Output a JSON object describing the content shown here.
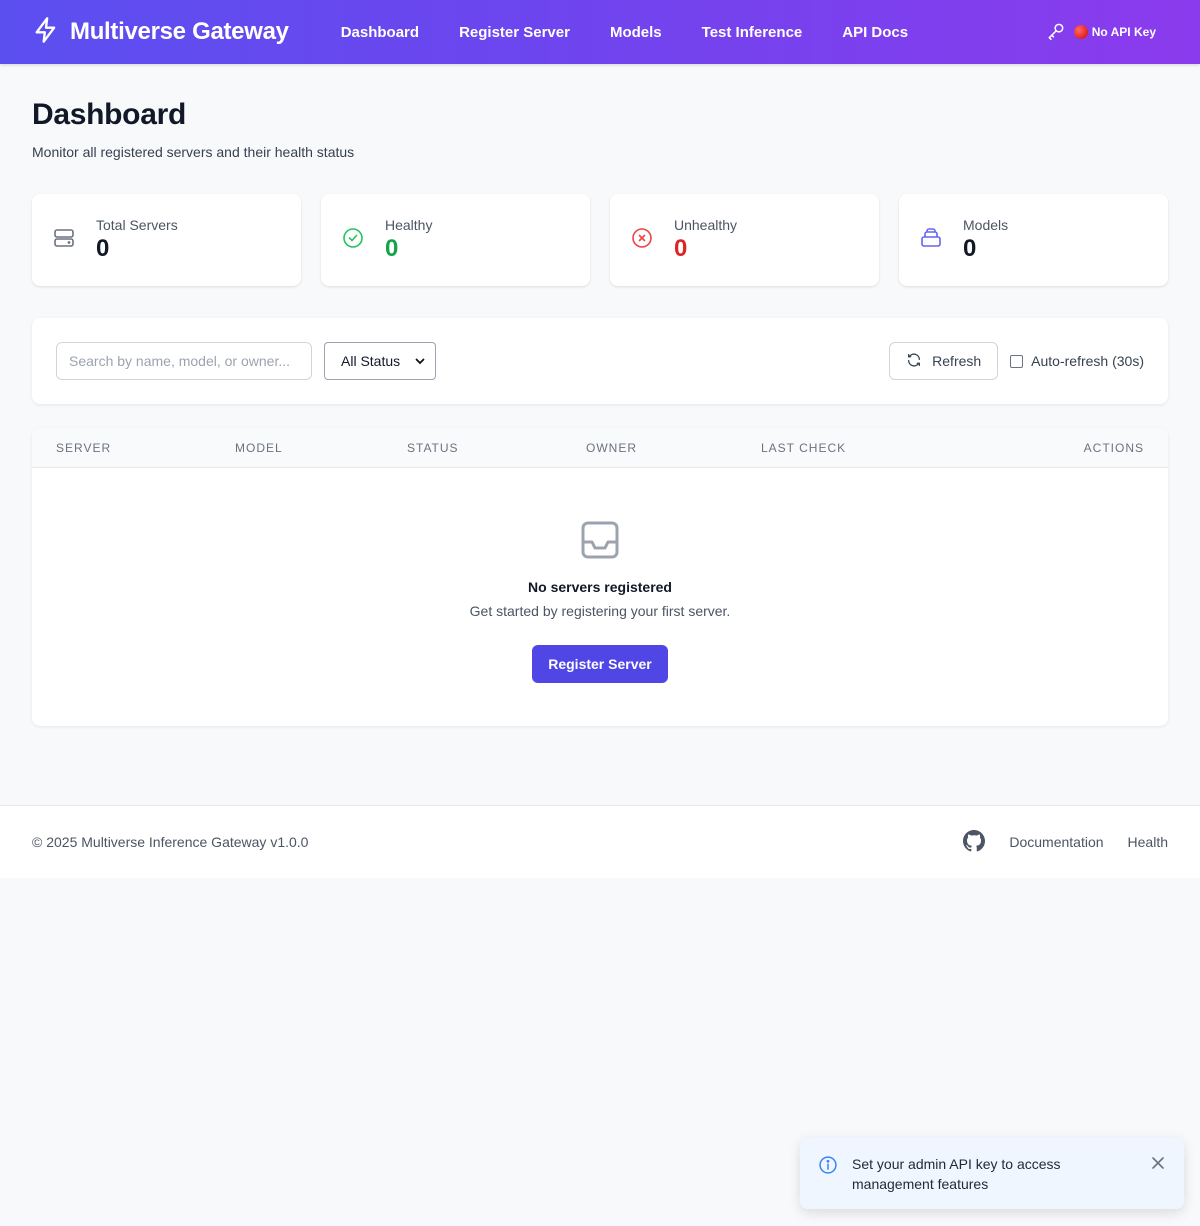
{
  "header": {
    "brand": "Multiverse Gateway",
    "nav": [
      "Dashboard",
      "Register Server",
      "Models",
      "Test Inference",
      "API Docs"
    ],
    "api_key_status": "No API Key"
  },
  "page": {
    "title": "Dashboard",
    "subtitle": "Monitor all registered servers and their health status"
  },
  "stats": [
    {
      "label": "Total Servers",
      "value": "0",
      "color": "#111827",
      "icon": "server-icon"
    },
    {
      "label": "Healthy",
      "value": "0",
      "color": "#16a34a",
      "icon": "check-circle-icon"
    },
    {
      "label": "Unhealthy",
      "value": "0",
      "color": "#dc2626",
      "icon": "x-circle-icon"
    },
    {
      "label": "Models",
      "value": "0",
      "color": "#111827",
      "icon": "cube-icon"
    }
  ],
  "filters": {
    "search_placeholder": "Search by name, model, or owner...",
    "status_selected": "All Status",
    "refresh_label": "Refresh",
    "autorefresh_label": "Auto-refresh (30s)"
  },
  "table": {
    "columns": [
      "SERVER",
      "MODEL",
      "STATUS",
      "OWNER",
      "LAST CHECK",
      "ACTIONS"
    ],
    "empty_title": "No servers registered",
    "empty_subtitle": "Get started by registering your first server.",
    "empty_button": "Register Server"
  },
  "footer": {
    "copyright": "© 2025 Multiverse Inference Gateway v1.0.0",
    "links": [
      "Documentation",
      "Health"
    ]
  },
  "toast": {
    "message": "Set your admin API key to access management features"
  },
  "colors": {
    "primary": "#4f46e5",
    "header_gradient_start": "#5b4ff0",
    "header_gradient_end": "#8b3bed"
  }
}
